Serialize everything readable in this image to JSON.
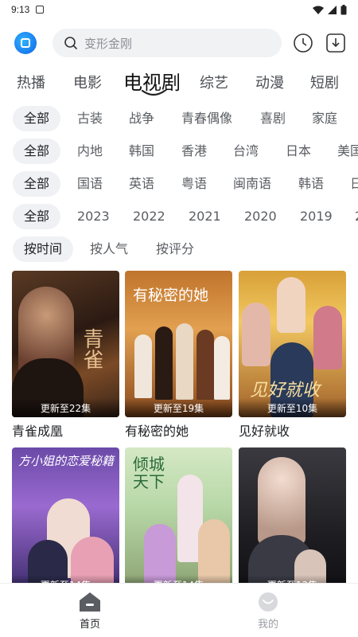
{
  "status_bar": {
    "time": "9:13"
  },
  "search": {
    "placeholder": "变形金刚"
  },
  "tabs": [
    "热播",
    "电影",
    "电视剧",
    "综艺",
    "动漫",
    "短剧"
  ],
  "filters": {
    "genre": [
      "全部",
      "古装",
      "战争",
      "青春偶像",
      "喜剧",
      "家庭"
    ],
    "region": [
      "全部",
      "内地",
      "韩国",
      "香港",
      "台湾",
      "日本",
      "美国"
    ],
    "language": [
      "全部",
      "国语",
      "英语",
      "粤语",
      "闽南语",
      "韩语",
      "日"
    ],
    "year": [
      "全部",
      "2023",
      "2022",
      "2021",
      "2020",
      "2019",
      "2"
    ],
    "sort": [
      "按时间",
      "按人气",
      "按评分"
    ]
  },
  "cards": [
    {
      "title": "青雀成凰",
      "badge": "更新至22集",
      "poster_text": "青雀"
    },
    {
      "title": "有秘密的她",
      "badge": "更新至19集",
      "poster_text": "有秘密的她"
    },
    {
      "title": "见好就收",
      "badge": "更新至10集",
      "poster_text": "见好就收"
    },
    {
      "title": "",
      "badge": "更新至14集",
      "poster_text": "方小姐的恋爱秘籍"
    },
    {
      "title": "",
      "badge": "更新至14集",
      "poster_text": "倾城天下"
    },
    {
      "title": "",
      "badge": "更新至13集",
      "poster_text": ""
    }
  ],
  "bottom_nav": [
    {
      "label": "首页",
      "icon": "home-icon",
      "active": true
    },
    {
      "label": "我的",
      "icon": "profile-icon",
      "active": false
    }
  ],
  "colors": {
    "chip_bg": "#f0f1f4",
    "search_bg": "#f1f2f4",
    "active_text": "#111111",
    "inactive_text": "#5a5d62"
  }
}
